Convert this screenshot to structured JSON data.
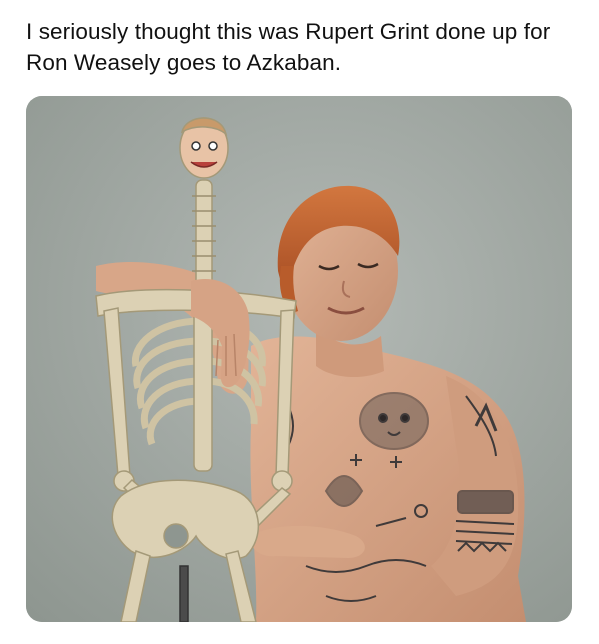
{
  "post": {
    "caption": "I seriously thought this was Rupert Grint done up for Ron Weasely goes to Azkaban."
  },
  "colors": {
    "page_background": "#ffffff",
    "caption_text": "#111111",
    "photo_backdrop": "#a3aaa6",
    "hair": "#c2622e",
    "skin": "#d9a98a",
    "bone": "#dcd1b4",
    "tattoo_ink": "#3f3a3a"
  }
}
